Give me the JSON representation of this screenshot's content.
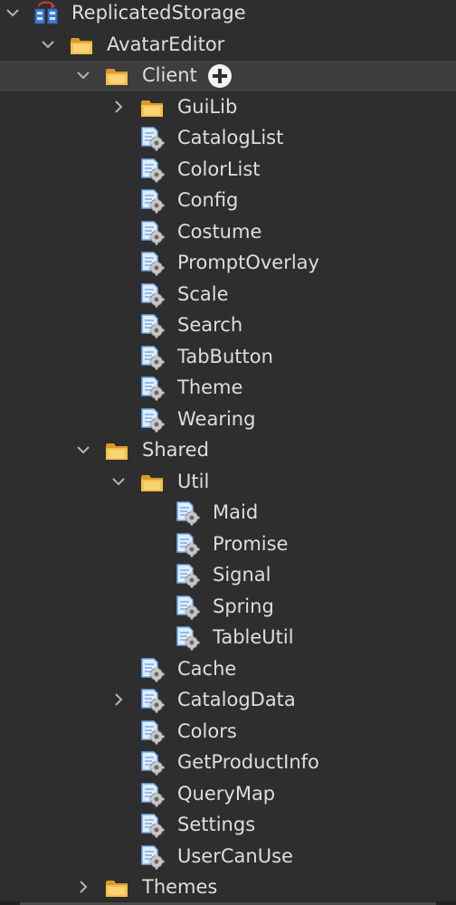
{
  "explorer": {
    "items": [
      {
        "label": "ReplicatedStorage",
        "kind": "storage",
        "chevron": "down",
        "icon_name": "replicated-storage-icon",
        "depth": 0
      },
      {
        "label": "AvatarEditor",
        "kind": "folder",
        "chevron": "down",
        "icon_name": "folder-icon",
        "depth": 1
      },
      {
        "label": "Client",
        "kind": "folder",
        "chevron": "down",
        "icon_name": "folder-icon",
        "depth": 2,
        "selected": true,
        "insert_button": true
      },
      {
        "label": "GuiLib",
        "kind": "folder",
        "chevron": "right",
        "icon_name": "folder-icon",
        "depth": 3
      },
      {
        "label": "CatalogList",
        "kind": "module",
        "chevron": "none",
        "icon_name": "module-script-icon",
        "depth": 3
      },
      {
        "label": "ColorList",
        "kind": "module",
        "chevron": "none",
        "icon_name": "module-script-icon",
        "depth": 3
      },
      {
        "label": "Config",
        "kind": "module",
        "chevron": "none",
        "icon_name": "module-script-icon",
        "depth": 3
      },
      {
        "label": "Costume",
        "kind": "module",
        "chevron": "none",
        "icon_name": "module-script-icon",
        "depth": 3
      },
      {
        "label": "PromptOverlay",
        "kind": "module",
        "chevron": "none",
        "icon_name": "module-script-icon",
        "depth": 3
      },
      {
        "label": "Scale",
        "kind": "module",
        "chevron": "none",
        "icon_name": "module-script-icon",
        "depth": 3
      },
      {
        "label": "Search",
        "kind": "module",
        "chevron": "none",
        "icon_name": "module-script-icon",
        "depth": 3
      },
      {
        "label": "TabButton",
        "kind": "module",
        "chevron": "none",
        "icon_name": "module-script-icon",
        "depth": 3
      },
      {
        "label": "Theme",
        "kind": "module",
        "chevron": "none",
        "icon_name": "module-script-icon",
        "depth": 3
      },
      {
        "label": "Wearing",
        "kind": "module",
        "chevron": "none",
        "icon_name": "module-script-icon",
        "depth": 3
      },
      {
        "label": "Shared",
        "kind": "folder",
        "chevron": "down",
        "icon_name": "folder-icon",
        "depth": 2
      },
      {
        "label": "Util",
        "kind": "folder",
        "chevron": "down",
        "icon_name": "folder-icon",
        "depth": 3
      },
      {
        "label": "Maid",
        "kind": "module",
        "chevron": "none",
        "icon_name": "module-script-icon",
        "depth": 4
      },
      {
        "label": "Promise",
        "kind": "module",
        "chevron": "none",
        "icon_name": "module-script-icon",
        "depth": 4
      },
      {
        "label": "Signal",
        "kind": "module",
        "chevron": "none",
        "icon_name": "module-script-icon",
        "depth": 4
      },
      {
        "label": "Spring",
        "kind": "module",
        "chevron": "none",
        "icon_name": "module-script-icon",
        "depth": 4
      },
      {
        "label": "TableUtil",
        "kind": "module",
        "chevron": "none",
        "icon_name": "module-script-icon",
        "depth": 4
      },
      {
        "label": "Cache",
        "kind": "module",
        "chevron": "none",
        "icon_name": "module-script-icon",
        "depth": 3
      },
      {
        "label": "CatalogData",
        "kind": "module",
        "chevron": "right",
        "icon_name": "module-script-icon",
        "depth": 3
      },
      {
        "label": "Colors",
        "kind": "module",
        "chevron": "none",
        "icon_name": "module-script-icon",
        "depth": 3
      },
      {
        "label": "GetProductInfo",
        "kind": "module",
        "chevron": "none",
        "icon_name": "module-script-icon",
        "depth": 3
      },
      {
        "label": "QueryMap",
        "kind": "module",
        "chevron": "none",
        "icon_name": "module-script-icon",
        "depth": 3
      },
      {
        "label": "Settings",
        "kind": "module",
        "chevron": "none",
        "icon_name": "module-script-icon",
        "depth": 3
      },
      {
        "label": "UserCanUse",
        "kind": "module",
        "chevron": "none",
        "icon_name": "module-script-icon",
        "depth": 3
      },
      {
        "label": "Themes",
        "kind": "folder",
        "chevron": "right",
        "icon_name": "folder-icon",
        "depth": 2
      }
    ],
    "insert_button_icon": "plus-circle-icon"
  },
  "colors": {
    "background": "#2e2e2e",
    "selected_row": "#3d3d3d",
    "text": "#dedede",
    "chevron": "#b4b4b4",
    "folder_yellow": "#f5c04a",
    "script_blue": "#6fa8e8",
    "gear_gray": "#c8c8c8"
  }
}
